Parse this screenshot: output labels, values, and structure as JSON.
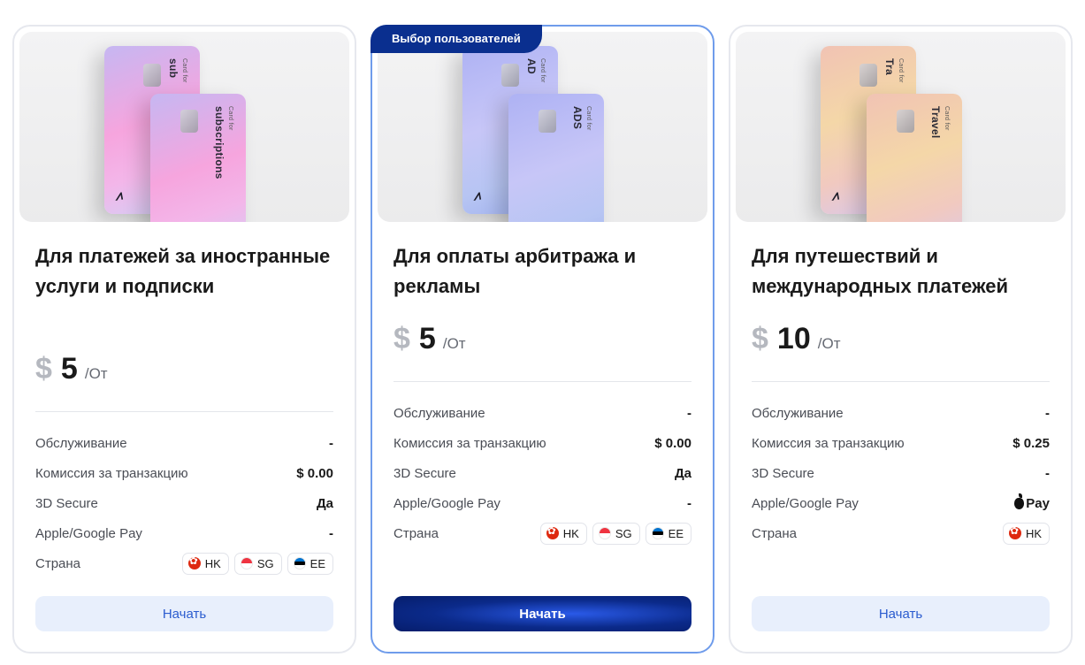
{
  "cards": [
    {
      "title": "Для платежей за иностранные услуги и подписки",
      "image": {
        "card_back_text": "sub",
        "card_front_text": "subscriptions",
        "card_caption": "Card for",
        "gradient": "pink"
      },
      "price": {
        "currency": "$",
        "amount": "5",
        "period": "/От"
      },
      "rows": [
        {
          "label": "Обслуживание",
          "value": "-"
        },
        {
          "label": "Комиссия за транзакцию",
          "value": "$ 0.00"
        },
        {
          "label": "3D Secure",
          "value": "Да"
        },
        {
          "label": "Apple/Google Pay",
          "value": "-"
        },
        {
          "label": "Страна",
          "flags": [
            "HK",
            "SG",
            "EE"
          ]
        }
      ],
      "button": "Начать"
    },
    {
      "badge": "Выбор пользователей",
      "title": "Для оплаты арбитража и рекламы",
      "image": {
        "card_back_text": "AD",
        "card_front_text": "ADS",
        "card_caption": "Card for",
        "gradient": "violet"
      },
      "price": {
        "currency": "$",
        "amount": "5",
        "period": "/От"
      },
      "rows": [
        {
          "label": "Обслуживание",
          "value": "-"
        },
        {
          "label": "Комиссия за транзакцию",
          "value": "$ 0.00"
        },
        {
          "label": "3D Secure",
          "value": "Да"
        },
        {
          "label": "Apple/Google Pay",
          "value": "-"
        },
        {
          "label": "Страна",
          "flags": [
            "HK",
            "SG",
            "EE"
          ]
        }
      ],
      "button": "Начать"
    },
    {
      "title": "Для путешествий и международных платежей",
      "image": {
        "card_back_text": "Tra",
        "card_front_text": "Travel",
        "card_caption": "Card for",
        "gradient": "travel"
      },
      "price": {
        "currency": "$",
        "amount": "10",
        "period": "/От"
      },
      "rows": [
        {
          "label": "Обслуживание",
          "value": "-"
        },
        {
          "label": "Комиссия за транзакцию",
          "value": "$ 0.25"
        },
        {
          "label": "3D Secure",
          "value": "-"
        },
        {
          "label": "Apple/Google Pay",
          "value": "Pay",
          "value_icon": "apple-icon"
        },
        {
          "label": "Страна",
          "flags": [
            "HK"
          ]
        }
      ],
      "button": "Начать"
    }
  ],
  "colors": {
    "badge_bg": "#0a2f8f",
    "featured_border": "#6f9ceb",
    "button_light_bg": "#e8effc",
    "button_light_text": "#2b5ccf",
    "button_dark_bg": "#0b2a8a"
  }
}
